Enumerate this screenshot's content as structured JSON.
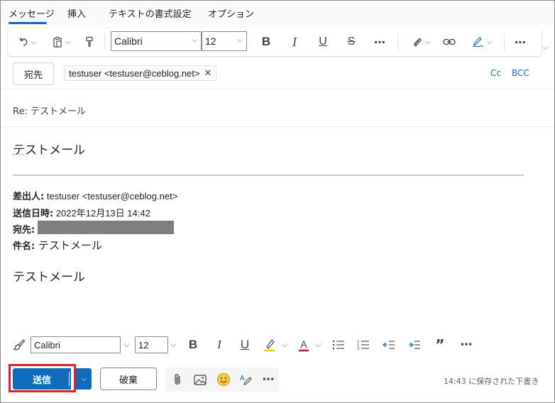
{
  "tabs": [
    {
      "label": "メッセージ",
      "active": true
    },
    {
      "label": "挿入"
    },
    {
      "label": "テキストの書式設定"
    },
    {
      "label": "オプション"
    }
  ],
  "ribbon": {
    "font_name": "Calibri",
    "font_size": "12",
    "bold": "B",
    "italic": "I",
    "underline": "U",
    "strike": "S",
    "more": "⋯"
  },
  "recipients": {
    "to_label": "宛先",
    "to_chip": "testuser <testuser@ceblog.net>",
    "cc": "Cc",
    "bcc": "BCC"
  },
  "subject": "Re: テストメール",
  "body": {
    "line1": "テストメール",
    "from_label": "差出人:",
    "from_value": " testuser <testuser@ceblog.net>",
    "sent_label": "送信日時:",
    "sent_value": " 2022年12月13日 14:42",
    "to_label": "宛先:",
    "subject_label": "件名:",
    "subject_value": " テストメール",
    "line2": "テストメール"
  },
  "format_bar": {
    "font_name": "Calibri",
    "font_size": "12",
    "bold": "B",
    "italic": "I",
    "underline": "U",
    "highlight": "A",
    "font_color": "A",
    "quote": "”",
    "more": "⋯"
  },
  "actions": {
    "send": "送信",
    "discard": "破棄",
    "more": "⋯",
    "draft_status": "14:43 に保存された下書き"
  },
  "colors": {
    "accent": "#0f6cbd",
    "send_highlight": "#e0202a",
    "highlight_yellow": "#ffd700",
    "font_color_red": "#d13438"
  }
}
